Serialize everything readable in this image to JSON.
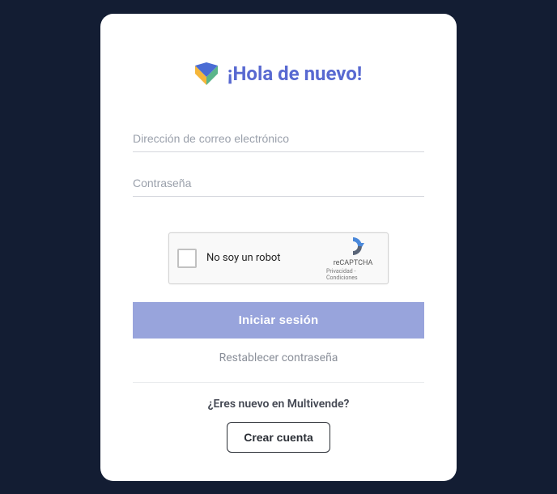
{
  "header": {
    "title": "¡Hola de nuevo!"
  },
  "form": {
    "email_placeholder": "Dirección de correo electrónico",
    "password_placeholder": "Contraseña",
    "email_value": "",
    "password_value": ""
  },
  "recaptcha": {
    "label": "No soy un robot",
    "brand": "reCAPTCHA",
    "terms": "Privacidad - Condiciones"
  },
  "buttons": {
    "login": "Iniciar sesión",
    "reset": "Restablecer contraseña",
    "create": "Crear cuenta"
  },
  "signup": {
    "prompt": "¿Eres nuevo en Multivende?"
  }
}
